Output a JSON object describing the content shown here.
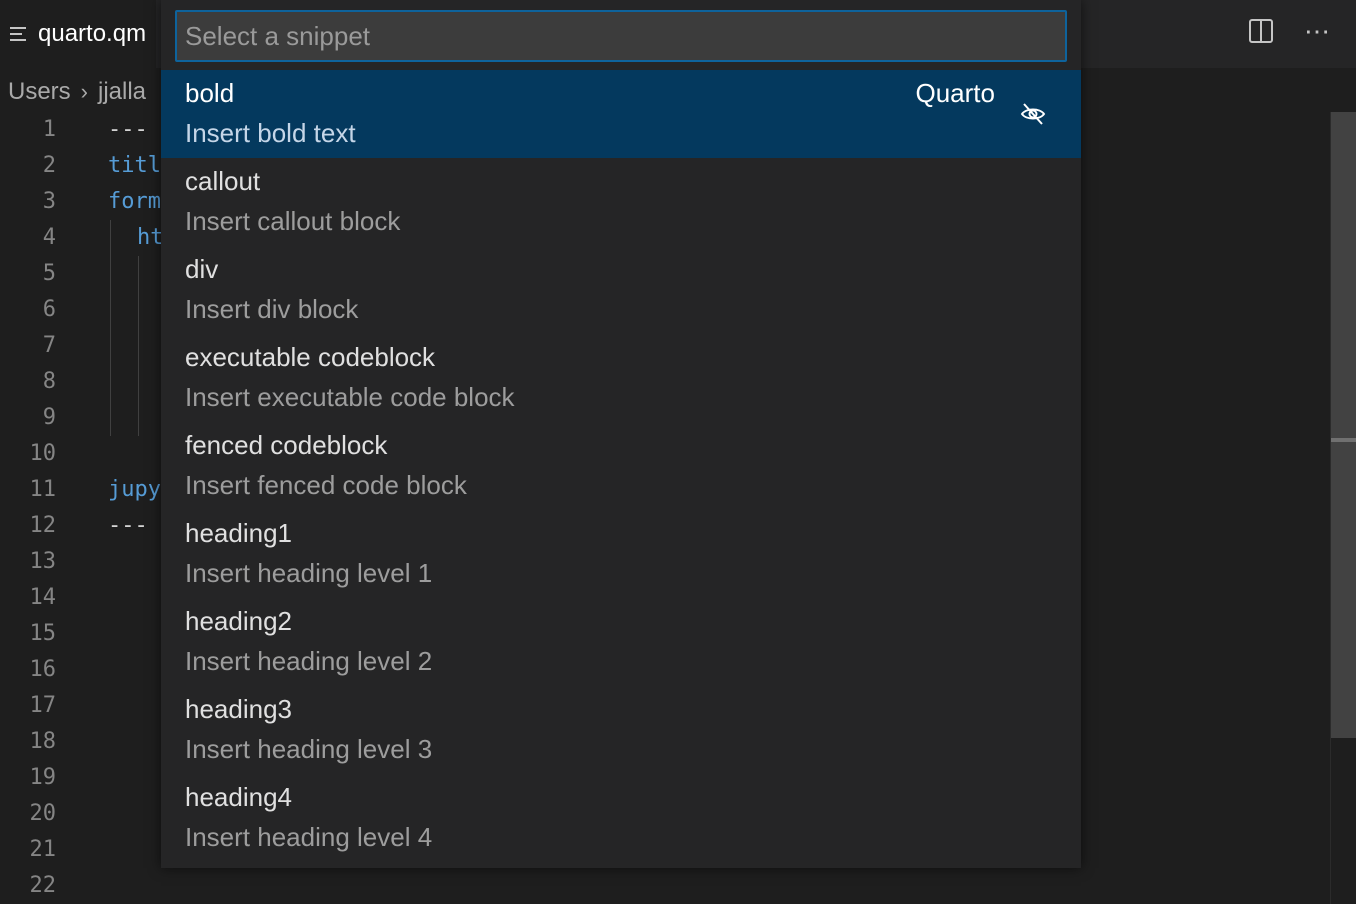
{
  "tab": {
    "title": "quarto.qm"
  },
  "breadcrumb": {
    "items": [
      "Users",
      "jjalla"
    ]
  },
  "editor": {
    "line_numbers": [
      "1",
      "2",
      "3",
      "4",
      "5",
      "6",
      "7",
      "8",
      "9",
      "10",
      "11",
      "12",
      "13",
      "14",
      "15",
      "16",
      "17",
      "18",
      "19",
      "20",
      "21",
      "22"
    ],
    "visible_code": {
      "l1": "---",
      "l2": "titl",
      "l3": "form",
      "l4": "ht",
      "l11": "jupy",
      "l12": "---"
    }
  },
  "quick_pick": {
    "placeholder": "Select a snippet",
    "items": [
      {
        "label": "bold",
        "description": "Insert bold text",
        "source": "Quarto"
      },
      {
        "label": "callout",
        "description": "Insert callout block"
      },
      {
        "label": "div",
        "description": "Insert div block"
      },
      {
        "label": "executable codeblock",
        "description": "Insert executable code block"
      },
      {
        "label": "fenced codeblock",
        "description": "Insert fenced code block"
      },
      {
        "label": "heading1",
        "description": "Insert heading level 1"
      },
      {
        "label": "heading2",
        "description": "Insert heading level 2"
      },
      {
        "label": "heading3",
        "description": "Insert heading level 3"
      },
      {
        "label": "heading4",
        "description": "Insert heading level 4"
      }
    ]
  },
  "icons": {
    "tab": "outline-list-icon",
    "split": "split-editor-icon",
    "more": "more-actions-icon",
    "hide": "eye-closed-icon",
    "breadcrumb_sep": "chevron-right-icon"
  },
  "colors": {
    "background": "#1e1e1e",
    "quickpick_bg": "#252526",
    "selection": "#04395e",
    "input_border": "#0e639c",
    "keyword": "#569cd6"
  }
}
